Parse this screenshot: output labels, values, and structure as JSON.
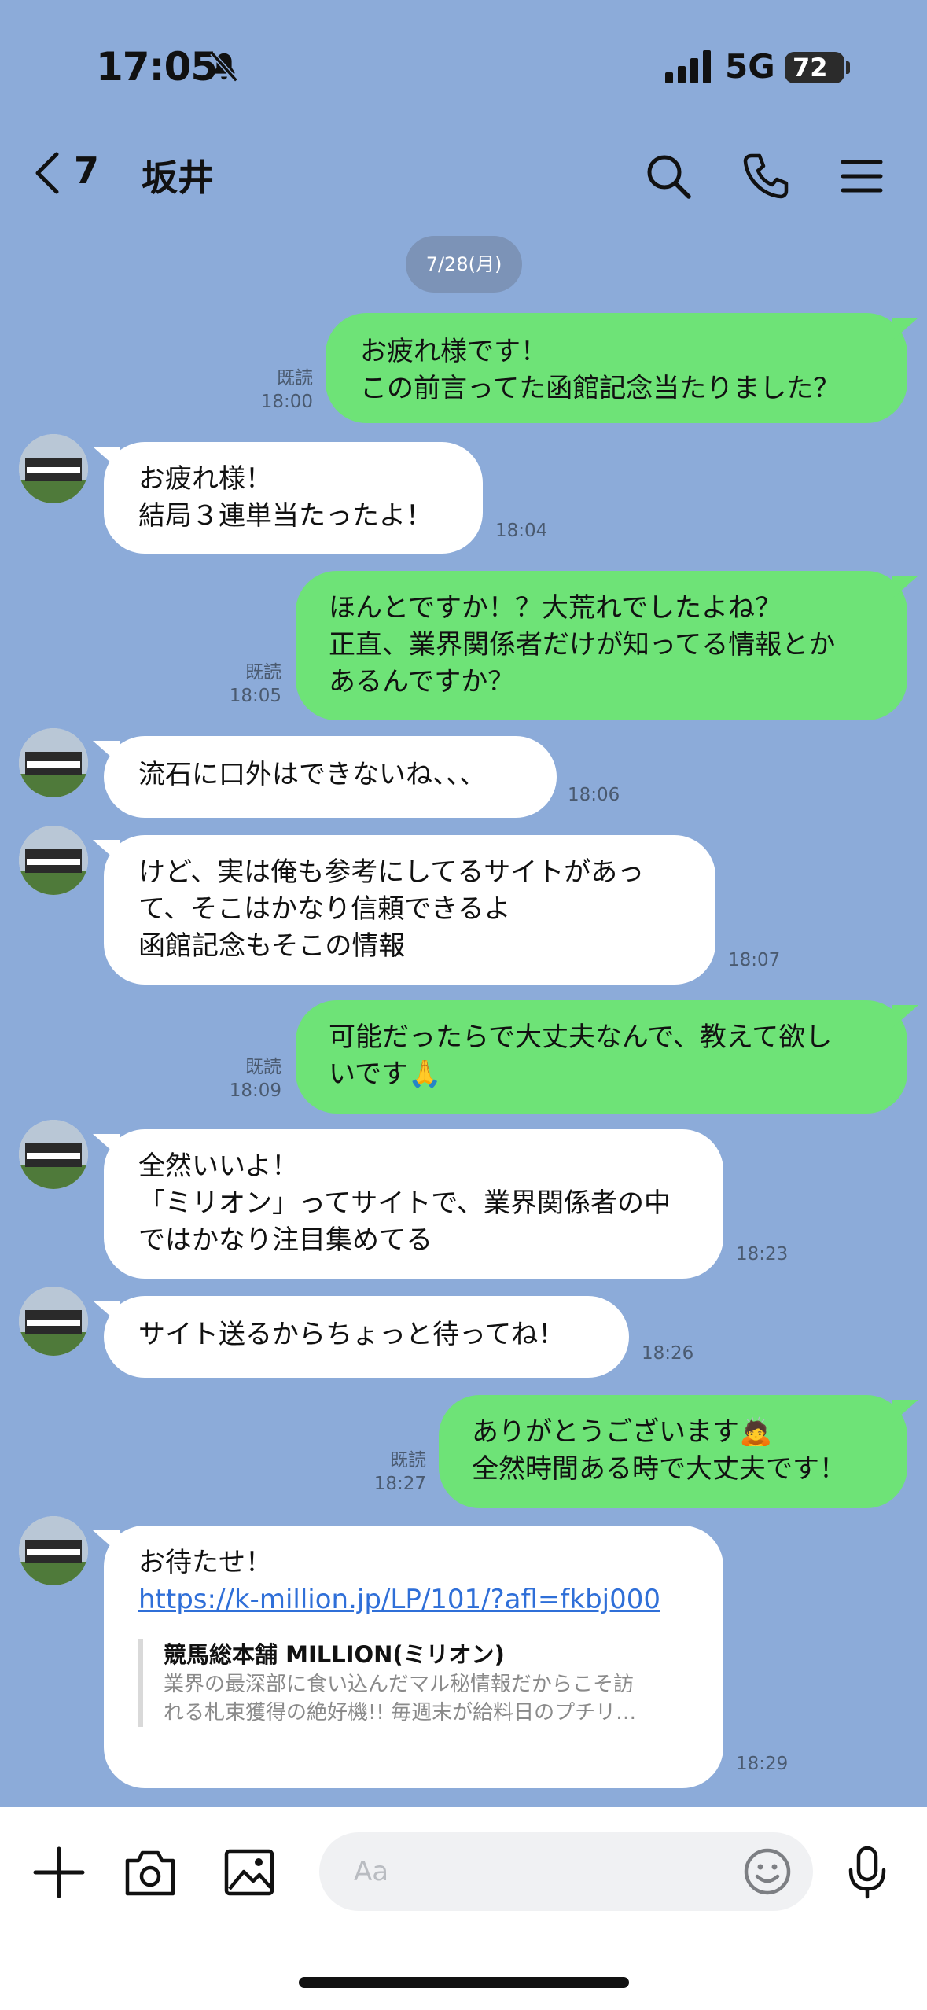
{
  "status": {
    "time": "17:05",
    "network": "5G",
    "battery": "72"
  },
  "header": {
    "back_count": "7",
    "title": "坂井"
  },
  "date_separator": "7/28(月)",
  "read_label": "既読",
  "messages": [
    {
      "dir": "out",
      "lines": [
        "お疲れ様です！",
        "この前言ってた函館記念当たりました？"
      ],
      "time": "18:00"
    },
    {
      "dir": "in",
      "lines": [
        "お疲れ様！",
        "結局３連単当たったよ！"
      ],
      "time": "18:04"
    },
    {
      "dir": "out",
      "lines": [
        "ほんとですか！？大荒れでしたよね？",
        "正直、業界関係者だけが知ってる情報とか",
        "あるんですか？"
      ],
      "time": "18:05"
    },
    {
      "dir": "in",
      "lines": [
        "流石に口外はできないね、、、"
      ],
      "time": "18:06"
    },
    {
      "dir": "in",
      "lines": [
        "けど、実は俺も参考にしてるサイトがあっ",
        "て、そこはかなり信頼できるよ",
        "函館記念もそこの情報"
      ],
      "time": "18:07"
    },
    {
      "dir": "out",
      "lines": [
        "可能だったらで大丈夫なんで、教えて欲し",
        "いです🙏"
      ],
      "time": "18:09"
    },
    {
      "dir": "in",
      "lines": [
        "全然いいよ！",
        "「ミリオン」ってサイトで、業界関係者の中",
        "ではかなり注目集めてる"
      ],
      "time": "18:23"
    },
    {
      "dir": "in",
      "lines": [
        "サイト送るからちょっと待ってね！"
      ],
      "time": "18:26"
    },
    {
      "dir": "out",
      "lines": [
        "ありがとうございます🙇",
        "全然時間ある時で大丈夫です！"
      ],
      "time": "18:27"
    },
    {
      "dir": "in",
      "lines": [
        "お待たせ！"
      ],
      "link": "https://k-million.jp/LP/101/?afl=fkbj000",
      "preview": {
        "title": "競馬総本舗 MILLION(ミリオン)",
        "desc": [
          "業界の最深部に食い込んだマル秘情報だからこそ訪",
          "れる札束獲得の絶好機!! 毎週末が給料日のプチリ…"
        ]
      },
      "time": "18:29"
    }
  ],
  "input": {
    "placeholder": "Aa"
  },
  "icons": [
    "chevron-left-icon",
    "search-icon",
    "phone-icon",
    "menu-icon",
    "plus-icon",
    "camera-icon",
    "image-icon",
    "emoji-icon",
    "microphone-icon",
    "bell-slash-icon"
  ]
}
